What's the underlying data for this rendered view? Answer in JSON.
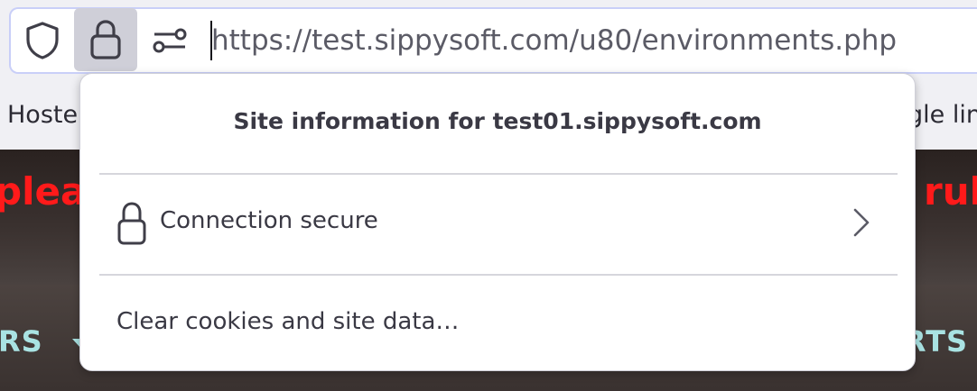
{
  "urlbar": {
    "url": "https://test.sippysoft.com/u80/environments.php"
  },
  "bookmarks": {
    "left_item": "Hoste",
    "right_item": "gle lin"
  },
  "page": {
    "banner_left": "pleas",
    "banner_right": "rul",
    "nav_left": "RS",
    "nav_right": "RTS",
    "banner_color": "#ff1a1a",
    "nav_color": "#a9e3e3"
  },
  "site_info_panel": {
    "title": "Site information for test01.sippysoft.com",
    "connection_label": "Connection secure",
    "clear_label": "Clear cookies and site data…"
  },
  "icons": {
    "tracking_protection": "shield-icon",
    "site_identity": "lock-icon",
    "permissions": "permissions-sliders-icon",
    "connection": "lock-icon",
    "expand": "chevron-right-icon"
  },
  "colors": {
    "urlbar_focus_border": "#c9cff8",
    "lock_button_active": "#cfcfd8"
  }
}
